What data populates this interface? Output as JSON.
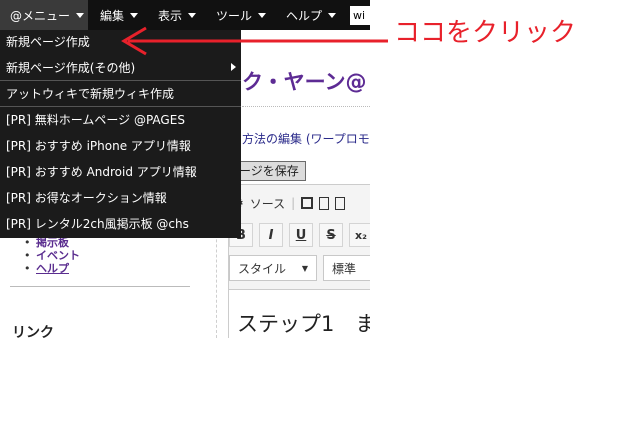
{
  "menubar": {
    "items": [
      {
        "label": "@メニュー"
      },
      {
        "label": "編集"
      },
      {
        "label": "表示"
      },
      {
        "label": "ツール"
      },
      {
        "label": "ヘルプ"
      }
    ],
    "search_value": "wi"
  },
  "dropdown": {
    "items": [
      "新規ページ作成",
      "新規ページ作成(その他)",
      "アットウィキで新規ウィキ作成",
      "[PR] 無料ホームページ @PAGES",
      "[PR] おすすめ iPhone アプリ情報",
      "[PR] おすすめ Android アプリ情報",
      "[PR] お得なオークション情報",
      "[PR] レンタル2ch風掲示板 @chs"
    ]
  },
  "page": {
    "title": "ク・ヤーン@",
    "edit_heading": "方法の編集 (ワープロモ",
    "save_button": "ージを保存",
    "source_label": "ソース",
    "style_combo": "スタイル",
    "format_combo": "標準",
    "editor_text": "ステップ1　ま"
  },
  "sidebar": {
    "links": [
      "掲示板",
      "イベント",
      "ヘルプ"
    ],
    "link_heading": "リンク"
  },
  "annotation": {
    "text": "ココをクリック",
    "color": "#e8212b"
  }
}
